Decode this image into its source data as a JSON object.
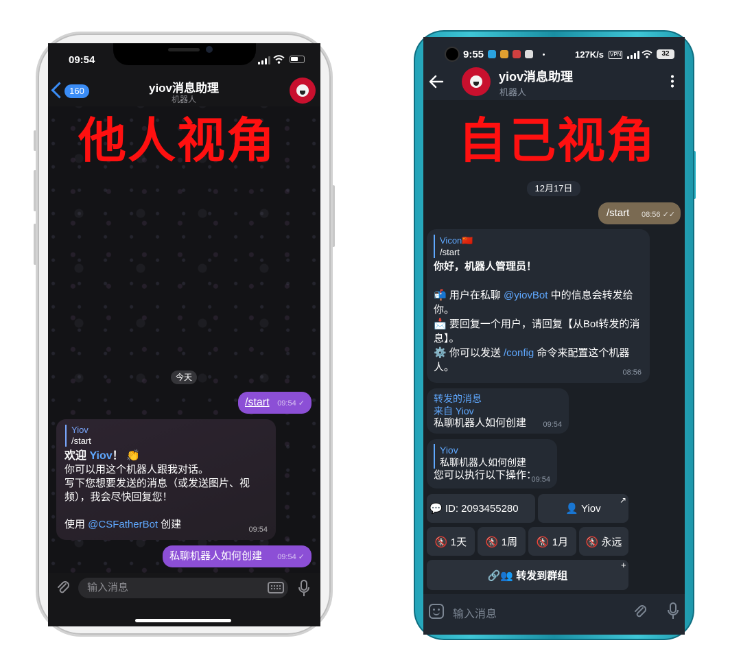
{
  "left_phone": {
    "status_time": "09:54",
    "header": {
      "title": "yiov消息助理",
      "subtitle": "机器人",
      "back_count": "160"
    },
    "overlay_label": "他人视角",
    "date_chip": "今天",
    "messages": {
      "out1": {
        "text": "/start",
        "time": "09:54"
      },
      "in1": {
        "reply_name": "Yiov",
        "reply_text": "/start",
        "greet_prefix": "欢迎 ",
        "greet_name": "Yiov",
        "greet_suffix": "！ 👏",
        "line1": "你可以用这个机器人跟我对话。",
        "line2": "写下您想要发送的消息（或发送图片、视频），我会尽快回复您！",
        "footer_prefix": "使用 ",
        "footer_link": "@CSFatherBot",
        "footer_suffix": " 创建",
        "time": "09:54"
      },
      "out2": {
        "text": "私聊机器人如何创建",
        "time": "09:54"
      }
    },
    "input_placeholder": "输入消息"
  },
  "right_phone": {
    "status_time": "9:55",
    "status_speed": "127K/s",
    "status_vpn": "VPN",
    "status_battery": "32",
    "header": {
      "title": "yiov消息助理",
      "subtitle": "机器人"
    },
    "overlay_label": "自己视角",
    "date_chip": "12月17日",
    "messages": {
      "out1": {
        "text": "/start",
        "time": "08:56"
      },
      "in1": {
        "reply_name": "Vicon🇨🇳",
        "reply_text": "/start",
        "greeting": "你好，机器人管理员！",
        "p1_prefix": "📬 用户在私聊 ",
        "p1_link": "@yiovBot",
        "p1_suffix": " 中的信息会转发给你。",
        "p2": "📩 要回复一个用户，请回复【从Bot转发的消息】。",
        "p3_prefix": "⚙️ 你可以发送 ",
        "p3_link": "/config",
        "p3_suffix": " 命令来配置这个机器人。",
        "time": "08:56"
      },
      "fwd": {
        "label": "转发的消息",
        "from": "来自 Yiov",
        "text": "私聊机器人如何创建",
        "time": "09:54"
      },
      "in2": {
        "reply_name": "Yiov",
        "reply_text": "私聊机器人如何创建",
        "text": "您可以执行以下操作：",
        "time": "09:54"
      }
    },
    "keyboard": {
      "id_button": "💬 ID: 2093455280",
      "user_button": "👤 Yiov",
      "ban_1d": "🚷 1天",
      "ban_1w": "🚷 1周",
      "ban_1m": "🚷 1月",
      "ban_forever": "🚷 永远",
      "forward_group": "🔗👥 转发到群组"
    },
    "input_placeholder": "输入消息"
  }
}
